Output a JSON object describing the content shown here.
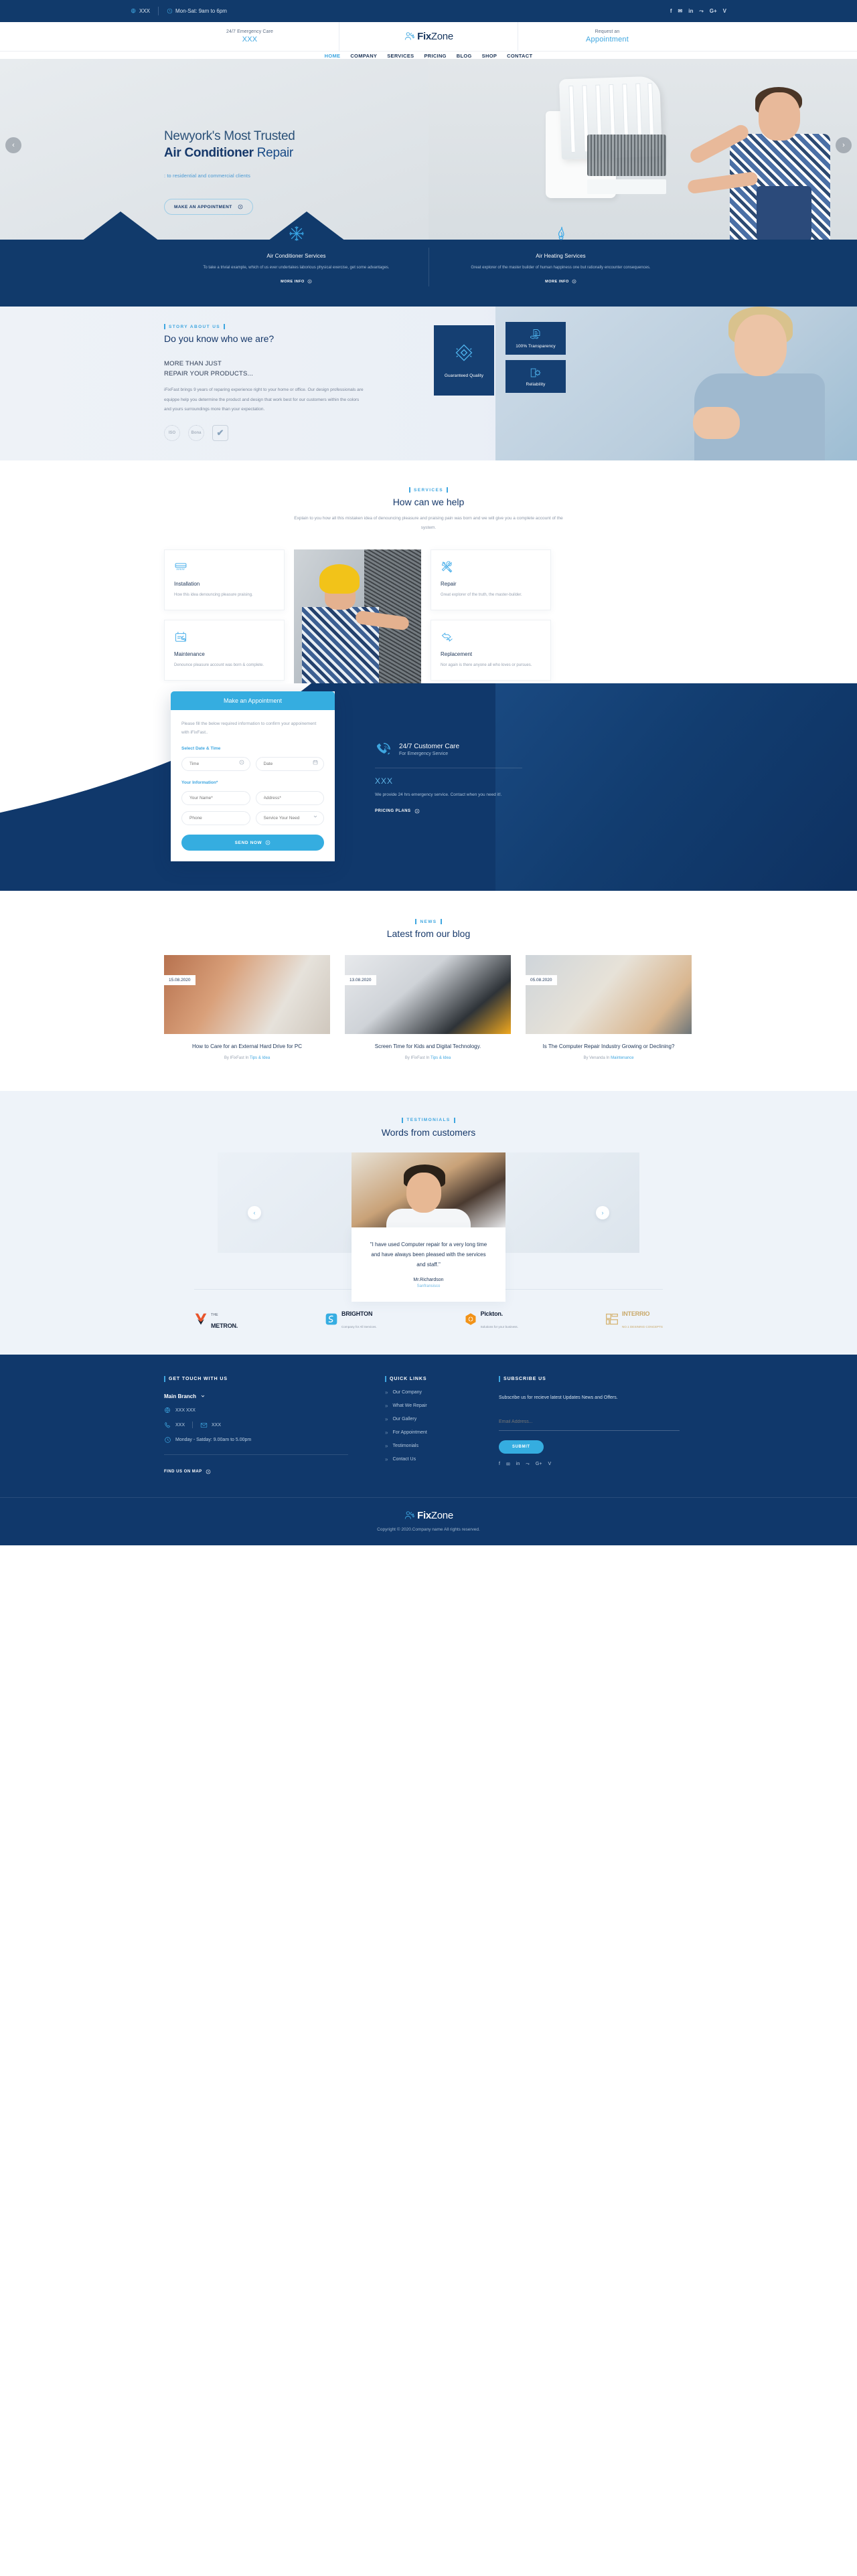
{
  "topbar": {
    "phone_icon": "globe-pin-icon",
    "phone": "XXX",
    "hours_icon": "clock-icon",
    "hours": "Mon-Sat: 9am to 6pm",
    "social": [
      "f",
      "✉",
      "in",
      "⤳",
      "G+",
      "V"
    ]
  },
  "header": {
    "emergency_label": "24/7 Emergency Care",
    "emergency_value": "XXX",
    "logo": {
      "brand_first": "Fix",
      "brand_second": "Zone",
      "icon": "person-wrench-icon"
    },
    "request_label": "Request an",
    "request_value": "Appointment",
    "nav": [
      {
        "label": "HOME",
        "active": true
      },
      {
        "label": "COMPANY",
        "active": false
      },
      {
        "label": "SERVICES",
        "active": false
      },
      {
        "label": "PRICING",
        "active": false
      },
      {
        "label": "BLOG",
        "active": false
      },
      {
        "label": "SHOP",
        "active": false
      },
      {
        "label": "CONTACT",
        "active": false
      }
    ]
  },
  "hero": {
    "title_line1": "Newyork's Most Trusted",
    "title_strong": "Air Conditioner",
    "title_rest": " Repair",
    "subtitle": ": to residential and commercial clients",
    "cta": "MAKE AN APPOINTMENT",
    "prev": "‹",
    "next": "›"
  },
  "strip": [
    {
      "icon": "snowflake-icon",
      "title": "Air Conditioner Services",
      "desc": "To take a trivial example, which of us ever undertakes laborious physical exercise, get some advantages.",
      "more": "MORE INFO"
    },
    {
      "icon": "flame-icon",
      "title": "Air Heating Services",
      "desc": "Great explorer of the master builder of human happiness one but rationally encounter consequences.",
      "more": "MORE INFO"
    }
  ],
  "about": {
    "eyebrow": "STORY ABOUT US",
    "heading": "Do you know who we are?",
    "subheading_line1": "MORE THAN JUST",
    "subheading_line2": "REPAIR YOUR PRODUCTS...",
    "paragraph": "iFixFast brings 9 years of reparing experience right to your home or office. Our design professionals are equippe help you determine the product and design that work best for our customers within the colors and yours surroundings more than your expectation.",
    "badges": [
      {
        "name": "iso-badge",
        "text": "ISO"
      },
      {
        "name": "certified-badge",
        "text": "Bona"
      },
      {
        "name": "approved-badge",
        "text": "✔"
      }
    ],
    "features": [
      {
        "icon": "diamond-quality-icon",
        "label": "Guaranteed Quality"
      },
      {
        "icon": "handshake-document-icon",
        "label": "100% Transparency"
      },
      {
        "icon": "gear-door-icon",
        "label": "Reliability"
      }
    ]
  },
  "services": {
    "eyebrow": "SERVICES",
    "heading": "How can we help",
    "paragraph": "Explain to you how all this mistaken idea of denouncing pleasure and praising pain was born and we will give you a complete account of the system.",
    "left": [
      {
        "icon": "ac-unit-icon",
        "title": "Installation",
        "desc": "How this idea denouncing pleasure praising."
      },
      {
        "icon": "maintenance-icon",
        "title": "Maintenance",
        "desc": "Denounce pleasure account was born & complete."
      }
    ],
    "right": [
      {
        "icon": "crossed-tools-icon",
        "title": "Repair",
        "desc": "Great explorer of the truth, the master-builder."
      },
      {
        "icon": "replacement-arrows-icon",
        "title": "Replacement",
        "desc": "Nor again is there anyone all who loves or pursues."
      }
    ]
  },
  "appointment": {
    "form_title": "Make an Appointment",
    "note": "Please fill the below required information to confirm your appoinement with iFixFast..",
    "section_datetime": "Select Date & Time",
    "section_info": "Your Information*",
    "fields": {
      "time_placeholder": "Time",
      "time_icon": "clock-icon",
      "date_placeholder": "Date",
      "date_icon": "calendar-icon",
      "name_placeholder": "Your Name*",
      "address_placeholder": "Address*",
      "phone_placeholder": "Phone",
      "service_placeholder": "Service Your Need",
      "service_icon": "chevron-down-icon"
    },
    "submit": "SEND NOW",
    "care": {
      "icon": "phone-24-icon",
      "title": "24/7 Customer Care",
      "subtitle": "For Emergency Service",
      "phone": "XXX",
      "desc": "We provide 24 hrs emergency service. Contact when you need it!.",
      "link": "PRICING PLANS"
    }
  },
  "blog": {
    "eyebrow": "NEWS",
    "heading": "Latest from our blog",
    "posts": [
      {
        "date": "15.08.2020",
        "title": "How to Care for an External Hard Drive for PC",
        "author": "By IFixFast In ",
        "category": "Tips & Idea"
      },
      {
        "date": "13.08.2020",
        "title": "Screen Time for Kids and Digital Technology.",
        "author": "By IFixFast In ",
        "category": "Tips & Idea"
      },
      {
        "date": "05.08.2020",
        "title": "Is The Computer Repair Industry Growing or Declining?",
        "author": "By Venanda In ",
        "category": "Maintenance"
      }
    ]
  },
  "testimonials": {
    "eyebrow": "TESTIMONIALS",
    "heading": "Words from customers",
    "quote": "\"I have used Computer repair for a very long time and have always been pleased with the services and staff.\"",
    "name": "Mr.Richardson",
    "location": "Sanfransisco",
    "prev": "‹",
    "next": "›"
  },
  "brands": [
    {
      "mark": "m-chevron-logo",
      "small": "THE",
      "big": "METRON.",
      "tag": ""
    },
    {
      "mark": "s-loop-logo",
      "small": "",
      "big": "BRIGHTON",
      "tag": "Company for All Services."
    },
    {
      "mark": "hex-logo",
      "small": "",
      "big": "Pickton.",
      "tag": "Solutions for your business."
    },
    {
      "mark": "blocks-logo",
      "small": "",
      "big": "INTERRIO",
      "tag": "NO.1 DESINING CONCEPTS"
    }
  ],
  "footer": {
    "contact": {
      "head": "GET TOUCH WITH US",
      "branch": "Main Branch",
      "branch_icon": "chevron-down-icon",
      "address_icon": "globe-pin-icon",
      "address": "XXX XXX",
      "phone_icon": "phone-icon",
      "phone": "XXX",
      "email_icon": "envelope-icon",
      "email": "XXX",
      "hours_icon": "clock-icon",
      "hours": "Monday - Satday: 9.00am to 5.00pm",
      "map_link": "FIND US ON MAP"
    },
    "quick": {
      "head": "QUICK LINKS",
      "links": [
        "Our Company",
        "What We Repair",
        "Our Gallery",
        "For Appointment",
        "Testimonials",
        "Contact Us"
      ]
    },
    "subscribe": {
      "head": "SUBSCRIBE US",
      "text": "Subscribe us for recieve latest Updates News and Offers.",
      "placeholder": "Email Address...",
      "button": "SUBMIT",
      "social": [
        "f",
        "✉",
        "in",
        "⤳",
        "G+",
        "V"
      ]
    },
    "copyright": "Copyright © 2020.Company name All rights reserved."
  },
  "colors": {
    "navy": "#10386b",
    "deep_navy": "#113a6b",
    "accent": "#3ea6e0",
    "light_accent": "#35ade0"
  }
}
